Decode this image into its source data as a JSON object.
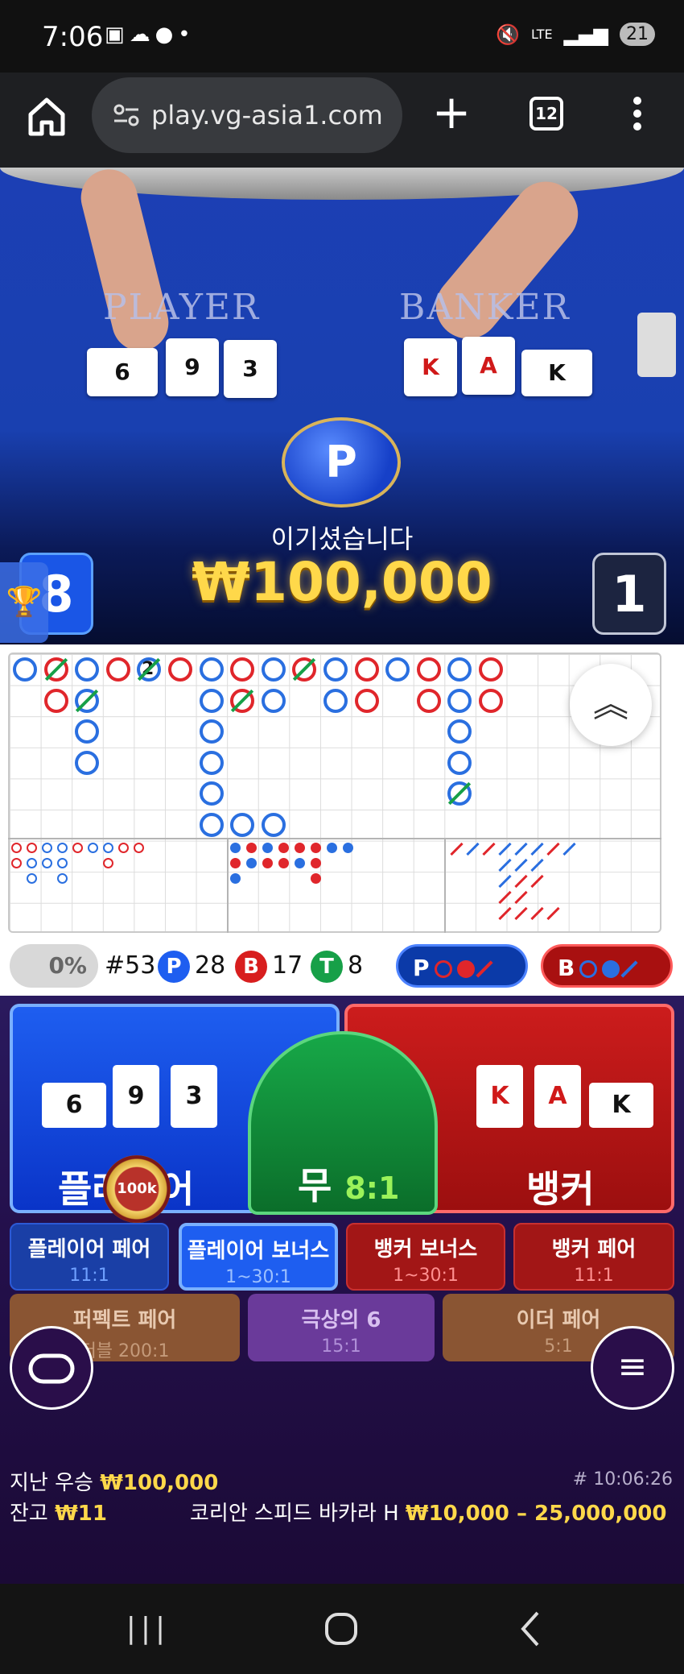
{
  "status_bar": {
    "time": "7:06",
    "left_icons": [
      "screenshot-icon",
      "messenger-icon",
      "chat-icon",
      "dot-icon"
    ],
    "right_icons": [
      "mute-icon",
      "lte-icon",
      "signal-icon"
    ],
    "network": "LTE",
    "battery": "21"
  },
  "browser": {
    "url": "play.vg-asia1.com",
    "tab_count": "12"
  },
  "video": {
    "player_label": "PLAYER",
    "banker_label": "BANKER",
    "player_cards": [
      "6",
      "9",
      "3"
    ],
    "banker_cards": [
      "K",
      "A",
      "K"
    ],
    "winner_badge": "P",
    "win_message": "이기셨습니다",
    "win_amount": "₩100,000",
    "left_count": "8",
    "right_count": "1"
  },
  "roadmap": {
    "tie_count_label": "2"
  },
  "stats": {
    "percent": "0%",
    "round_no": "#53",
    "p_badge": "P",
    "p_count": "28",
    "b_badge": "B",
    "b_count": "17",
    "t_badge": "T",
    "t_count": "8",
    "predict_player": "P",
    "predict_banker": "B"
  },
  "betting": {
    "player_label": "플레이어",
    "tie_label": "무",
    "tie_odds": "8:1",
    "banker_label": "뱅커",
    "chip_label": "100k",
    "player_cards": [
      "6",
      "9",
      "3"
    ],
    "banker_cards": [
      "K",
      "A",
      "K"
    ],
    "side_bets": [
      {
        "name": "플레이어 페어",
        "odds": "11:1"
      },
      {
        "name": "플레이어 보너스",
        "odds": "1~30:1"
      },
      {
        "name": "뱅커 보너스",
        "odds": "1~30:1"
      },
      {
        "name": "뱅커 페어",
        "odds": "11:1"
      }
    ],
    "side_bets2": [
      {
        "name": "퍼펙트 페어",
        "odds": "더블 200:1"
      },
      {
        "name": "극상의 6",
        "odds": "15:1"
      },
      {
        "name": "이더 페어",
        "odds": "5:1"
      }
    ],
    "last_win_label": "지난 우승",
    "last_win_amount": "₩100,000",
    "balance_label": "잔고",
    "balance_amount": "₩11",
    "game_time": "# 10:06:26",
    "table_name": "코리안 스피드 바카라 H",
    "bet_limits": "₩10,000 – 25,000,000"
  },
  "colors": {
    "player": "#1e5ef0",
    "banker": "#cc1c1c",
    "tie": "#17a848",
    "gold": "#ffd84a"
  }
}
